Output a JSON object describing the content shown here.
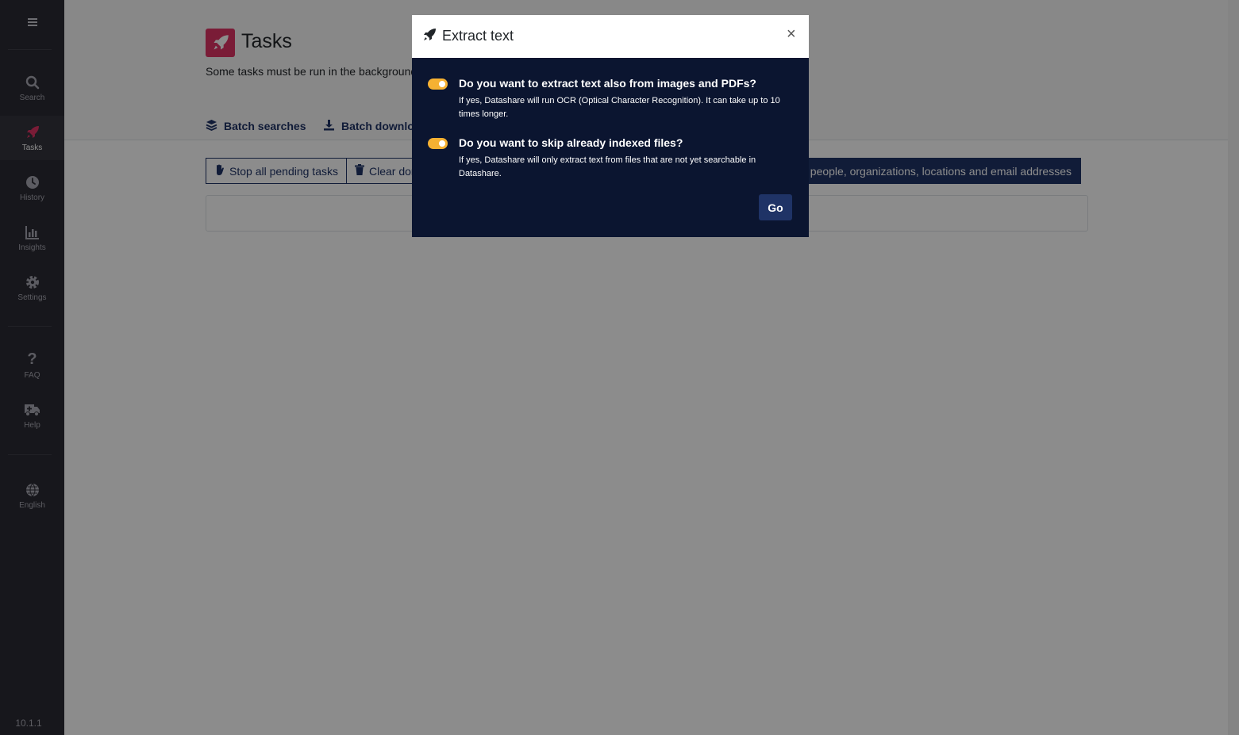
{
  "sidebar": {
    "items": [
      {
        "label": "Search",
        "icon": "search-icon"
      },
      {
        "label": "Tasks",
        "icon": "rocket-icon",
        "active": true
      },
      {
        "label": "History",
        "icon": "clock-icon"
      },
      {
        "label": "Insights",
        "icon": "chart-icon"
      },
      {
        "label": "Settings",
        "icon": "gear-icon"
      }
    ],
    "help_items": [
      {
        "label": "FAQ",
        "icon": "question-icon"
      },
      {
        "label": "Help",
        "icon": "ambulance-icon"
      }
    ],
    "language": {
      "label": "English",
      "icon": "globe-icon"
    },
    "version": "10.1.1"
  },
  "page": {
    "title": "Tasks",
    "description": "Some tasks must be run in the background.",
    "tabs": [
      {
        "label": "Batch searches",
        "icon": "layers-icon"
      },
      {
        "label": "Batch downloa",
        "icon": "download-icon"
      }
    ],
    "buttons": {
      "stop": "Stop all pending tasks",
      "clear": "Clear don",
      "find": "nd people, organizations, locations and email addresses"
    }
  },
  "modal": {
    "title": "Extract text",
    "close": "×",
    "options": [
      {
        "question": "Do you want to extract text also from images and PDFs?",
        "description": "If yes, Datashare will run OCR (Optical Character Recognition). It can take up to 10 times longer.",
        "enabled": true
      },
      {
        "question": "Do you want to skip already indexed files?",
        "description": "If yes, Datashare will only extract text from files that are not yet searchable in Datashare.",
        "enabled": true
      }
    ],
    "go_label": "Go"
  },
  "colors": {
    "sidebar": "#2b2b33",
    "brand_navy": "#1f3366",
    "accent_pink": "#de3364",
    "toggle_on": "#f6b132",
    "modal_body": "#0b1530"
  }
}
